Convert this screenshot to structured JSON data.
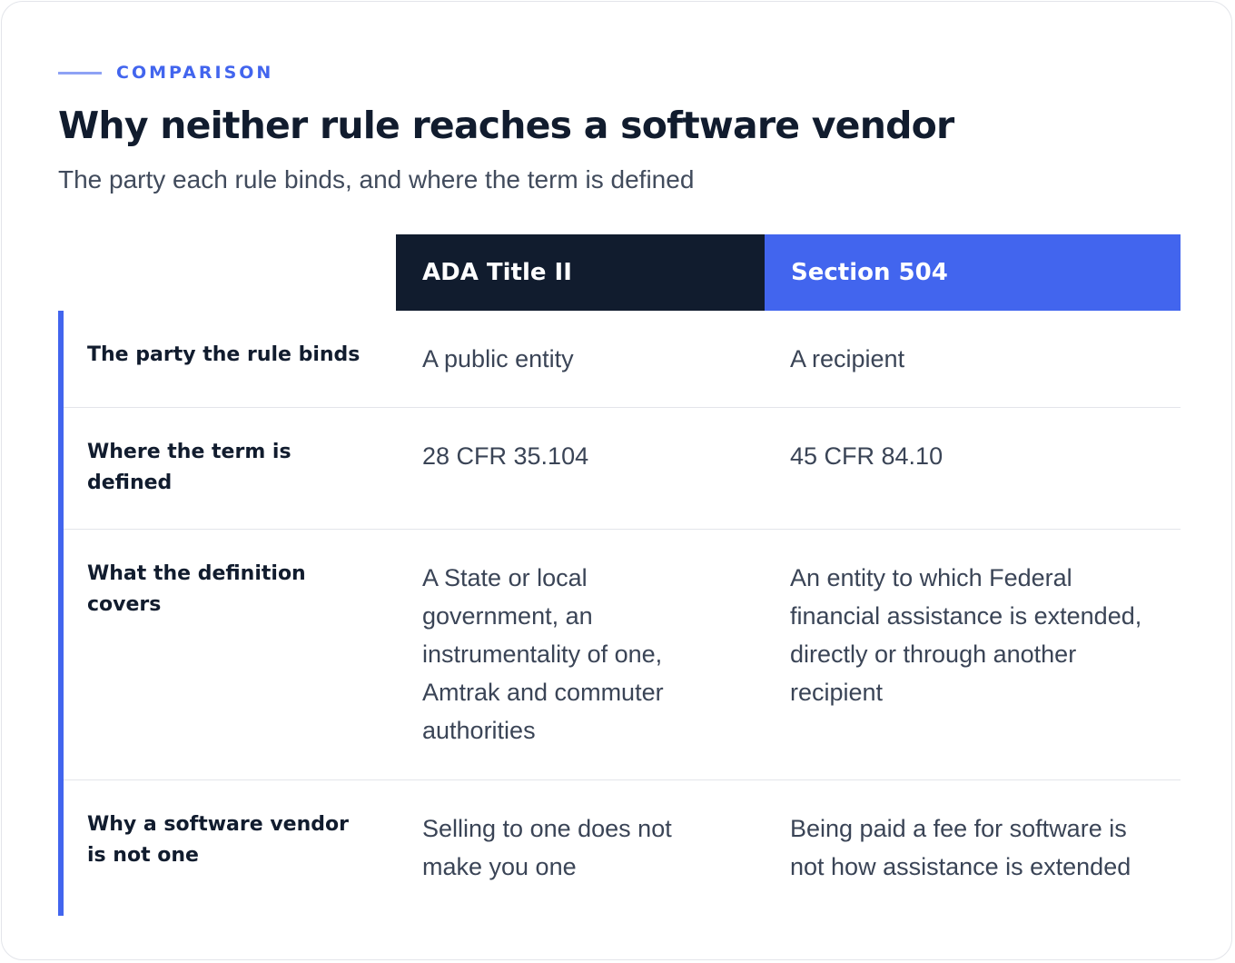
{
  "eyebrow": "COMPARISON",
  "title": "Why neither rule reaches a software vendor",
  "subtitle": "The party each rule binds, and where the term is defined",
  "columns": [
    "ADA Title II",
    "Section 504"
  ],
  "rows": [
    {
      "label": "The party the rule binds",
      "ada": "A public entity",
      "s504": "A recipient"
    },
    {
      "label": "Where the term is defined",
      "ada": "28 CFR 35.104",
      "s504": "45 CFR 84.10"
    },
    {
      "label": "What the definition covers",
      "ada": "A State or local government, an instrumentality of one, Amtrak and commuter authorities",
      "s504": "An entity to which Federal financial assistance is extended, directly or through another recipient"
    },
    {
      "label": "Why a software vendor is not one",
      "ada": "Selling to one does not make you one",
      "s504": "Being paid a fee for software is not how assistance is extended"
    }
  ],
  "colors": {
    "accent": "#4265ee",
    "dark": "#111c2e",
    "muted_text": "#3a4456",
    "divider": "#e3e5ea"
  }
}
